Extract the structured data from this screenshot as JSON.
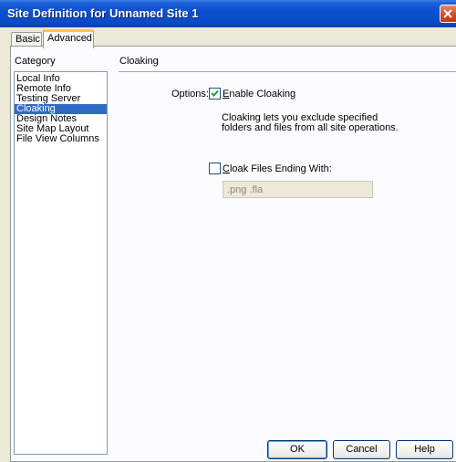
{
  "window": {
    "title": "Site Definition for Unnamed Site 1",
    "close_icon": "close-icon"
  },
  "tabs": [
    {
      "label": "Basic",
      "selected": false
    },
    {
      "label": "Advanced",
      "selected": true
    }
  ],
  "category": {
    "label": "Category",
    "items": [
      {
        "label": "Local Info",
        "selected": false
      },
      {
        "label": "Remote Info",
        "selected": false
      },
      {
        "label": "Testing Server",
        "selected": false
      },
      {
        "label": "Cloaking",
        "selected": true
      },
      {
        "label": "Design Notes",
        "selected": false
      },
      {
        "label": "Site Map Layout",
        "selected": false
      },
      {
        "label": "File View Columns",
        "selected": false
      }
    ]
  },
  "cloaking": {
    "section_title": "Cloaking",
    "options_label": "Options:",
    "enable_cloaking": {
      "label_accel": "E",
      "label_rest": "nable Cloaking",
      "checked": true
    },
    "description": "Cloaking lets you exclude specified folders and files from all site operations.",
    "cloak_files": {
      "label_accel": "C",
      "label_rest": "loak Files Ending With:",
      "checked": false
    },
    "extensions_value": ".png .fla"
  },
  "buttons": {
    "ok": "OK",
    "cancel": "Cancel",
    "help": "Help"
  },
  "colors": {
    "titlebar": "#0a4fd0",
    "selection": "#316ac5",
    "dialog_bg": "#ece9d8",
    "tab_highlight": "#ffc83c"
  }
}
